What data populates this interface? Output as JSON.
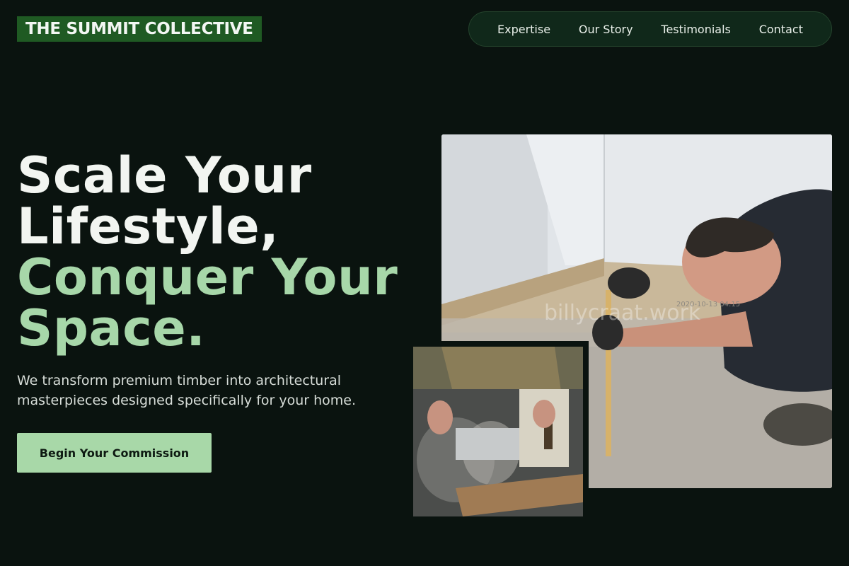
{
  "brand": {
    "name": "THE SUMMIT COLLECTIVE"
  },
  "nav": {
    "items": [
      {
        "label": "Expertise"
      },
      {
        "label": "Our Story"
      },
      {
        "label": "Testimonials"
      },
      {
        "label": "Contact"
      }
    ]
  },
  "hero": {
    "title_line1": "Scale Your",
    "title_line2": "Lifestyle,",
    "title_accent_line1": "Conquer Your",
    "title_accent_line2": "Space.",
    "subtitle": "We transform premium timber into architectural masterpieces designed specifically for your home.",
    "cta_label": "Begin Your Commission"
  },
  "images": {
    "main_watermark": "billycraat.work",
    "main_stamp": "2020-10-13  04:15"
  },
  "colors": {
    "background": "#0a130f",
    "brand_bg": "#1f5a23",
    "nav_bg": "#10281a",
    "accent": "#a7d7a9",
    "cta_bg": "#a8d8a8"
  }
}
